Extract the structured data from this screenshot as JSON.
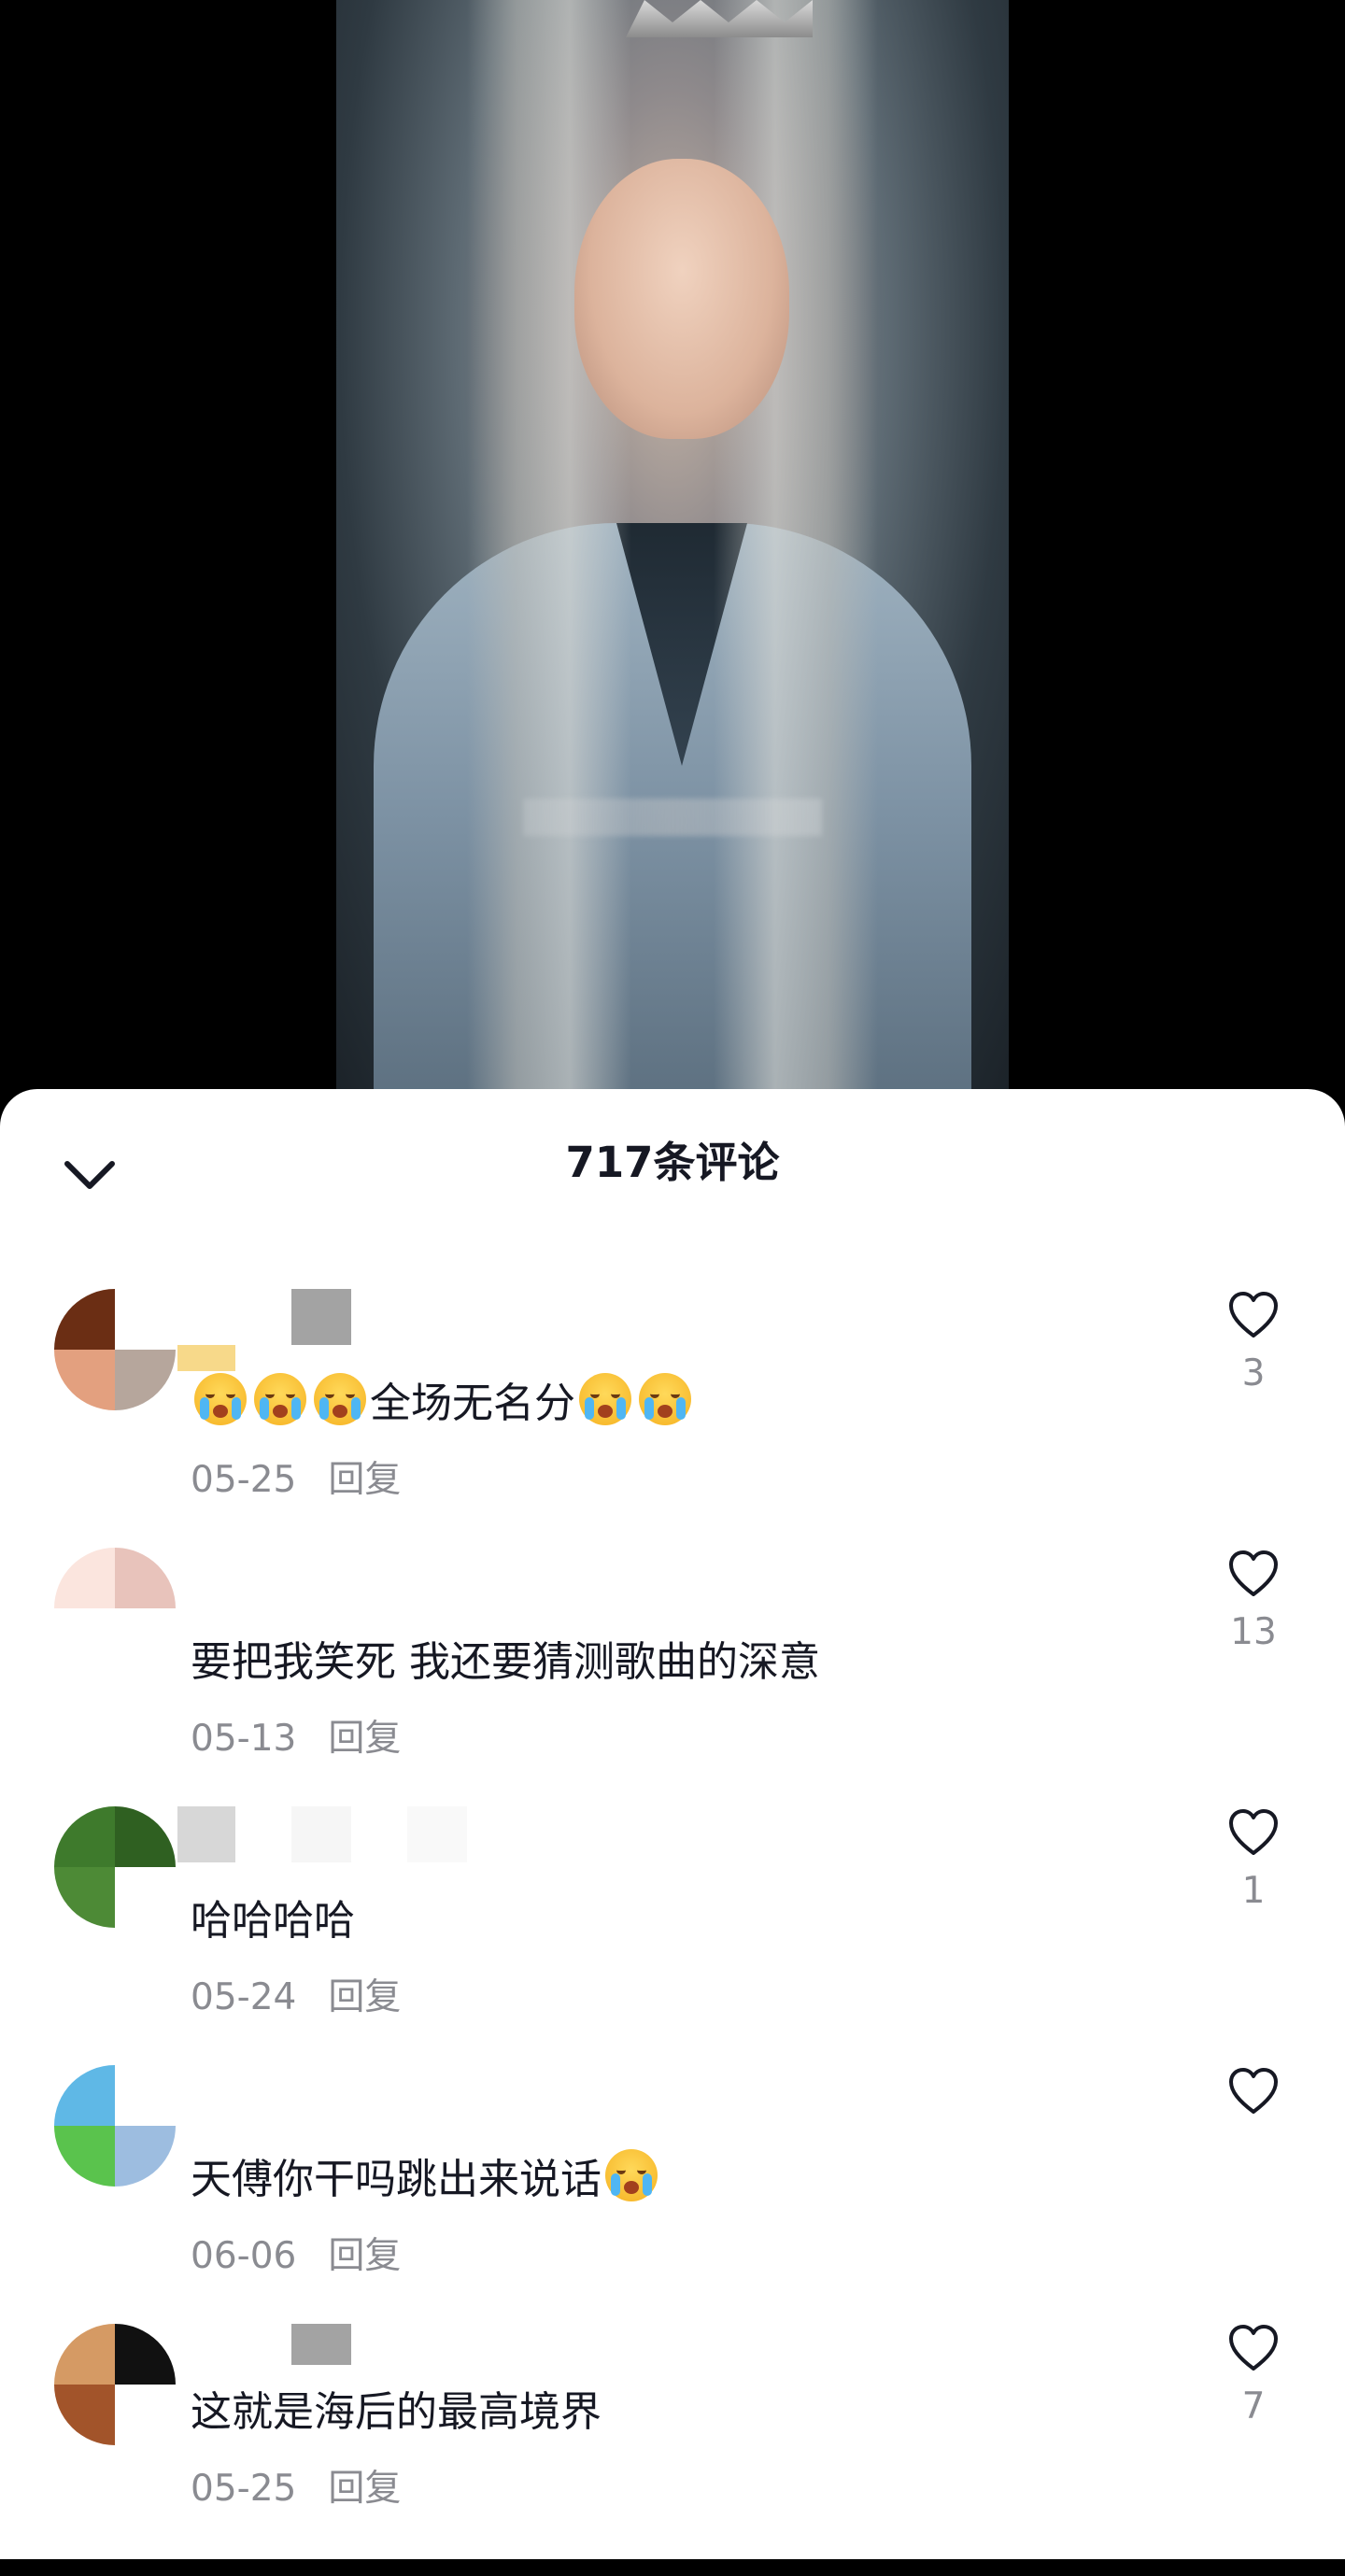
{
  "sheet": {
    "title": "717条评论"
  },
  "icons": {
    "collapse": "chevron-down-icon",
    "like": "heart-outline-icon",
    "emoji": "loudly-crying-face-emoji"
  },
  "comments": [
    {
      "text_main": "全场无名分",
      "date": "05-25",
      "reply_label": "回复",
      "likes": "3"
    },
    {
      "text_main": "要把我笑死 我还要猜测歌曲的深意",
      "date": "05-13",
      "reply_label": "回复",
      "likes": "13"
    },
    {
      "text_main": "哈哈哈哈",
      "date": "05-24",
      "reply_label": "回复",
      "likes": "1"
    },
    {
      "text_main": "天傅你干吗跳出来说话",
      "date": "06-06",
      "reply_label": "回复",
      "likes": ""
    },
    {
      "text_main": "这就是海后的最高境界",
      "date": "05-25",
      "reply_label": "回复",
      "likes": "7"
    }
  ]
}
